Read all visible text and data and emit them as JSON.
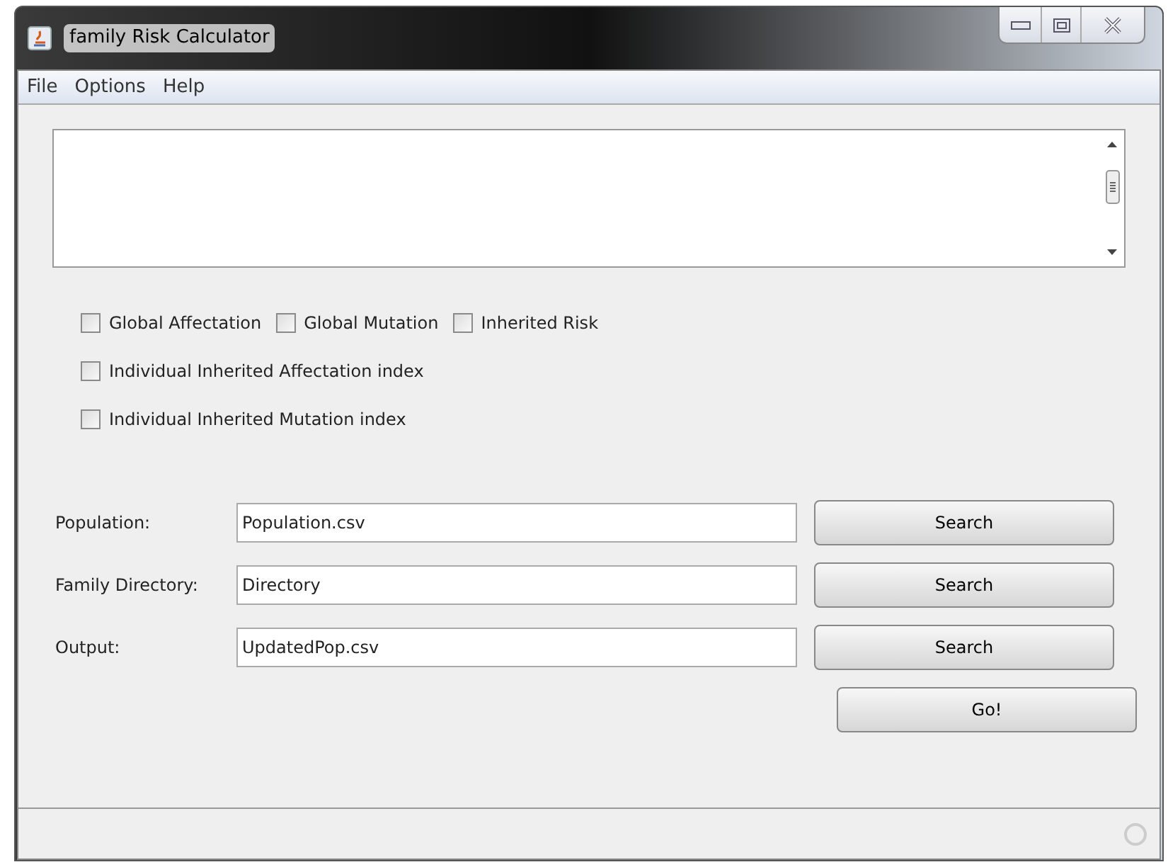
{
  "window": {
    "title": "family Risk Calculator"
  },
  "menu": [
    "File",
    "Options",
    "Help"
  ],
  "checkbox_rows": [
    [
      {
        "label": "Global Affectation",
        "checked": false
      },
      {
        "label": "Global Mutation",
        "checked": false
      },
      {
        "label": "Inherited Risk",
        "checked": false
      }
    ],
    [
      {
        "label": "Individual Inherited Affectation index",
        "checked": false
      }
    ],
    [
      {
        "label": "Individual Inherited Mutation index",
        "checked": false
      }
    ]
  ],
  "file_rows": [
    {
      "label": "Population:",
      "value": "Population.csv",
      "button": "Search"
    },
    {
      "label": "Family Directory:",
      "value": "Directory",
      "button": "Search"
    },
    {
      "label": "Output:",
      "value": "UpdatedPop.csv",
      "button": "Search"
    }
  ],
  "go_button": "Go!"
}
